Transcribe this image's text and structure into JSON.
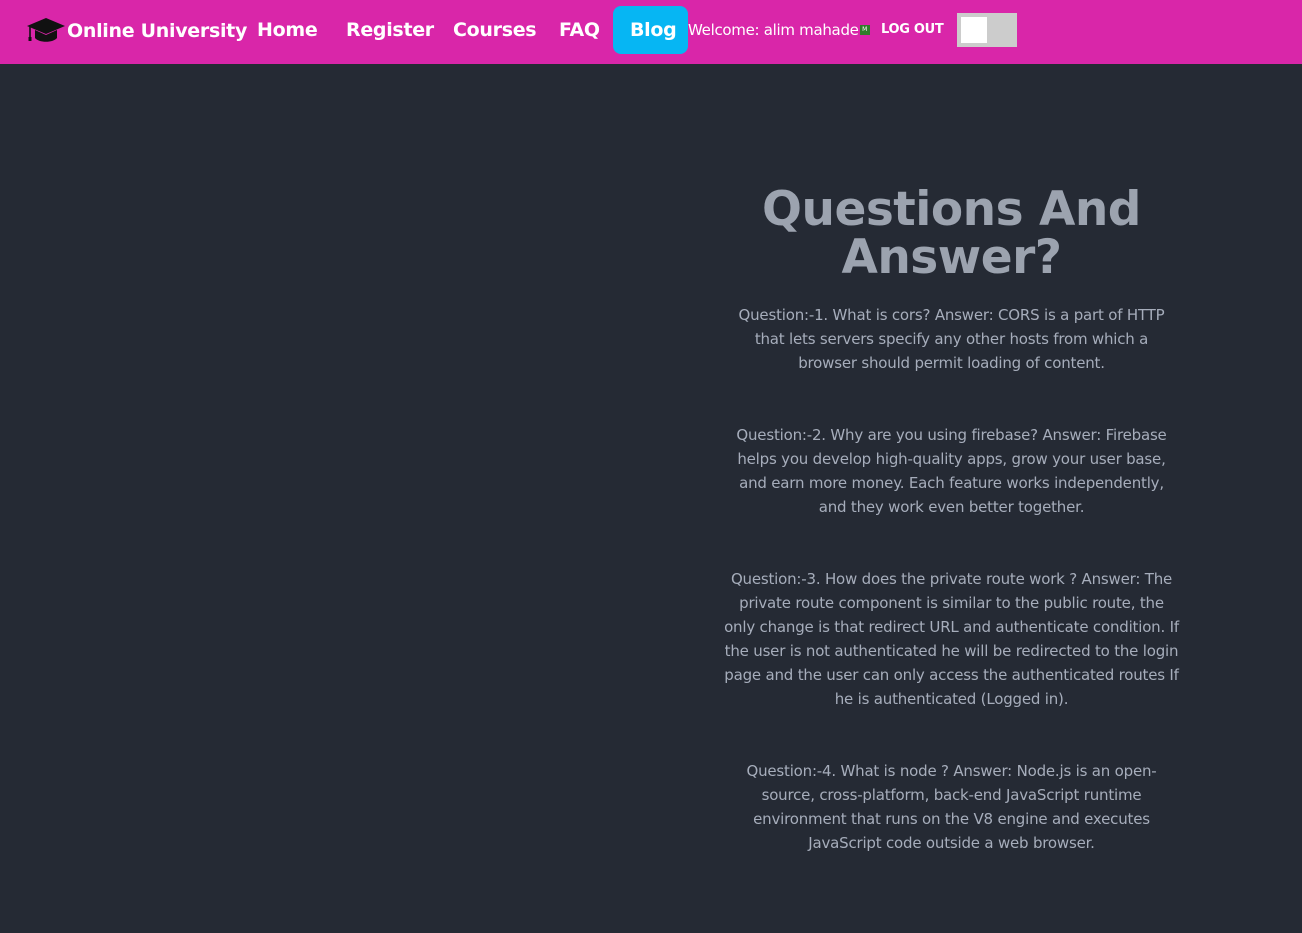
{
  "navbar": {
    "brand": "Online University",
    "links": [
      {
        "label": "Home"
      },
      {
        "label": "Register"
      },
      {
        "label": "Courses"
      },
      {
        "label": "FAQ"
      },
      {
        "label": "Blog",
        "active": true
      }
    ],
    "welcome": "Welcome: alim mahade",
    "avatar_text": "M",
    "logout_label": "LOG OUT",
    "theme_toggle": {
      "on": false
    }
  },
  "main": {
    "title": "Questions And Answer?",
    "questions": [
      "Question:-1. What is cors? Answer: CORS is a part of HTTP that lets servers specify any other hosts from which a browser should permit loading of content.",
      "Question:-2. Why are you using firebase? Answer: Firebase helps you develop high-quality apps, grow your user base, and earn more money. Each feature works independently, and they work even better together.",
      "Question:-3. How does the private route work ? Answer: The private route component is similar to the public route, the only change is that redirect URL and authenticate condition. If the user is not authenticated he will be redirected to the login page and the user can only access the authenticated routes If he is authenticated (Logged in).",
      "Question:-4. What is node ? Answer: Node.js is an open-source, cross-platform, back-end JavaScript runtime environment that runs on the V8 engine and executes JavaScript code outside a web browser."
    ]
  },
  "colors": {
    "navbar_bg": "#d926a9",
    "active_link_bg": "#06b6f3",
    "page_bg": "#252a34",
    "title_color": "#9ca3af",
    "text_color": "#a6adbb",
    "toggle_track": "#cccccc"
  },
  "icons": {
    "brand_icon": "graduation-cap-icon"
  }
}
